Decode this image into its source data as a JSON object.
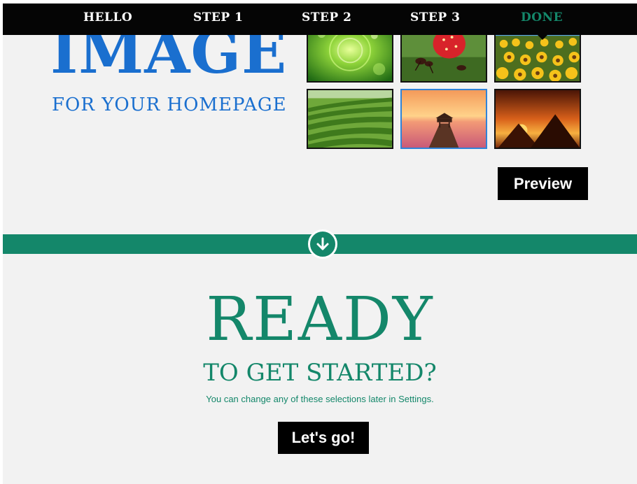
{
  "nav": {
    "items": [
      {
        "label": "HELLO"
      },
      {
        "label": "STEP 1"
      },
      {
        "label": "STEP 2"
      },
      {
        "label": "STEP 3"
      },
      {
        "label": "DONE",
        "active": true
      }
    ]
  },
  "header": {
    "title": "IMAGE",
    "subtitle": "FOR YOUR HOMEPAGE"
  },
  "gallery": {
    "thumbnails": [
      {
        "icon": "green-bubbles-image"
      },
      {
        "icon": "ants-strawberry-image"
      },
      {
        "icon": "sunflowers-image"
      },
      {
        "icon": "tea-field-image"
      },
      {
        "icon": "pier-sunset-image",
        "selected": true
      },
      {
        "icon": "pyramids-sunset-image"
      }
    ]
  },
  "preview_button": {
    "label": "Preview"
  },
  "divider": {
    "icon": "arrow-down-circle-icon"
  },
  "ready": {
    "title": "READY",
    "subtitle": "TO GET STARTED?",
    "note": "You can change any of these selections later in Settings.",
    "button_label": "Let's go!"
  },
  "colors": {
    "accent_green": "#14876a",
    "accent_blue": "#1a6fcf",
    "nav_bg": "#050505",
    "page_bg": "#f2f2f2"
  }
}
